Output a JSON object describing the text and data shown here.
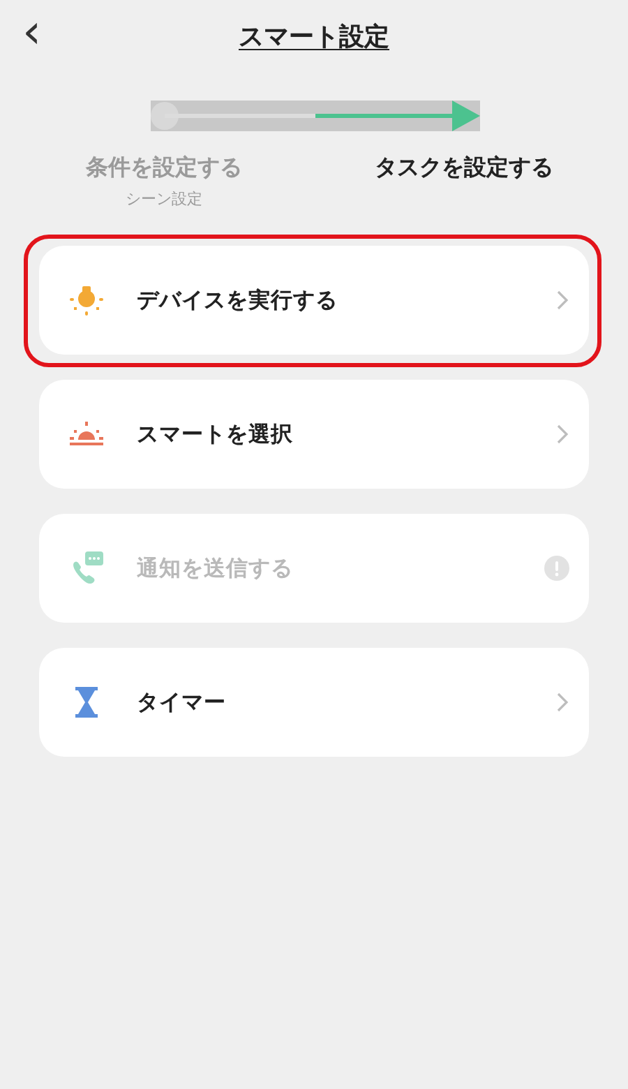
{
  "header": {
    "back_icon": "‹",
    "title": "スマート設定"
  },
  "steps": [
    {
      "label": "条件を設定する",
      "sublabel": "シーン設定",
      "selected": false
    },
    {
      "label": "タスクを設定する",
      "selected": true
    }
  ],
  "actions": [
    {
      "kind": "bulb",
      "label": "デバイスを実行する",
      "disabled": false,
      "highlighted": true
    },
    {
      "kind": "sunrise",
      "label": "スマートを選択",
      "disabled": false,
      "highlighted": false
    },
    {
      "kind": "message",
      "label": "通知を送信する",
      "disabled": true,
      "highlighted": false
    },
    {
      "kind": "timer",
      "label": "タイマー",
      "disabled": false,
      "highlighted": false
    }
  ]
}
